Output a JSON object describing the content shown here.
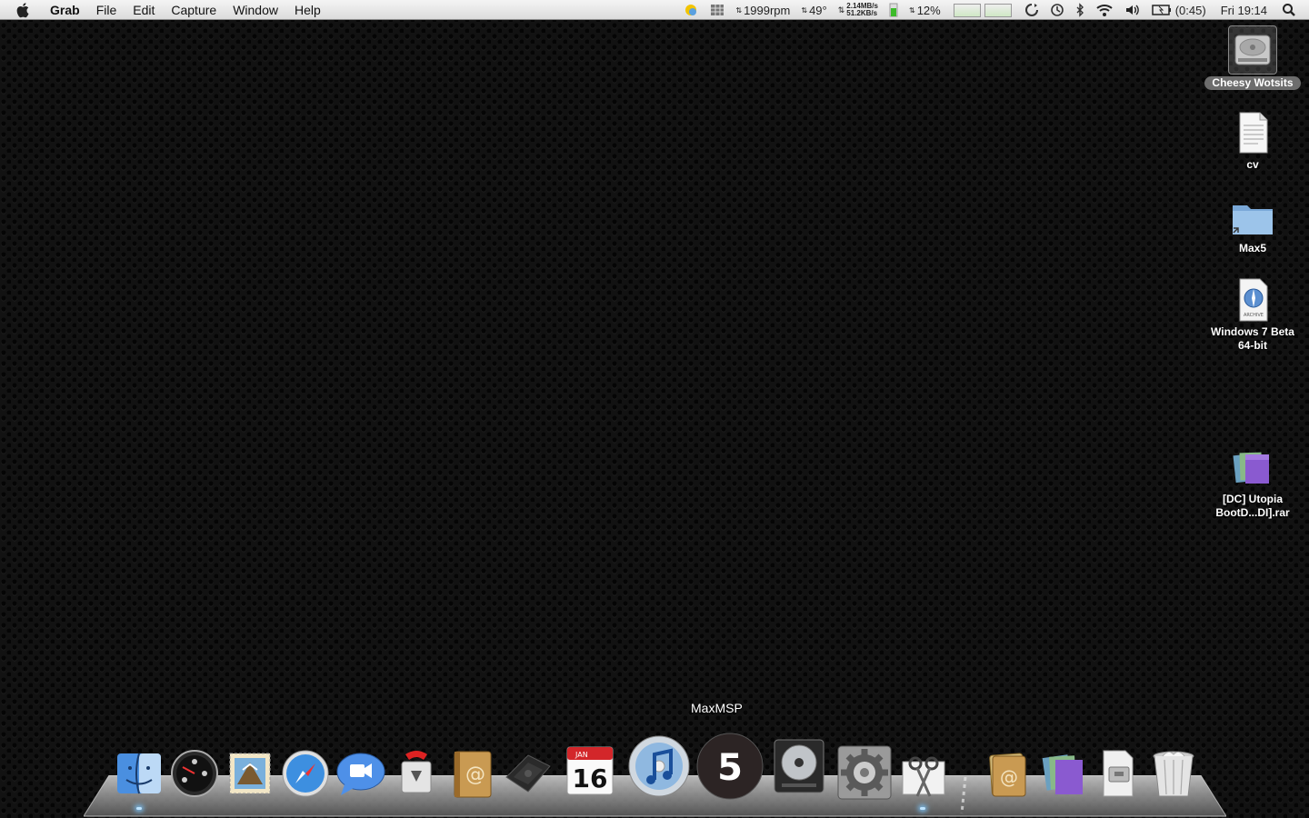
{
  "menubar": {
    "app_name": "Grab",
    "items": [
      "File",
      "Edit",
      "Capture",
      "Window",
      "Help"
    ],
    "status": {
      "fan_speed": "1999rpm",
      "temperature": "49°",
      "net_up": "2.14MB/s",
      "net_down": "51.2KB/s",
      "cpu": "12%",
      "battery": "(0:45)",
      "clock": "Fri 19:14"
    }
  },
  "desktop": {
    "icons": [
      {
        "label": "Cheesy Wotsits",
        "type": "hard-drive",
        "selected": true
      },
      {
        "label": "cv",
        "type": "document"
      },
      {
        "label": "Max5",
        "type": "folder-alias"
      },
      {
        "label": "Windows 7 Beta 64-bit",
        "label_line1": "Windows 7 Beta",
        "label_line2": "64-bit",
        "type": "archive",
        "badge": "ARCHIVE"
      },
      {
        "label": "[DC] Utopia BootD...DI].rar",
        "label_line1": "[DC] Utopia",
        "label_line2": "BootD...DI].rar",
        "type": "rar-archive"
      }
    ]
  },
  "dock": {
    "tooltip": "MaxMSP",
    "calendar": {
      "month": "JAN",
      "day": "16"
    },
    "maxmsp_glyph": "5",
    "apps": [
      "Finder",
      "Dashboard",
      "Mail",
      "Safari",
      "iChat",
      "Transmit",
      "Address Book",
      "Sega",
      "iCal",
      "iTunes",
      "MaxMSP",
      "Logic",
      "System Preferences",
      "Grab"
    ],
    "stacks": [
      "Address Book Stack",
      "Documents Stack",
      "Downloads Stack",
      "Trash"
    ]
  },
  "colors": {
    "menubar_bg": "#e8e8e8",
    "desktop_bg": "#121212",
    "selection_bg": "#6d6d6d",
    "running_indicator": "#bfe4ff"
  }
}
